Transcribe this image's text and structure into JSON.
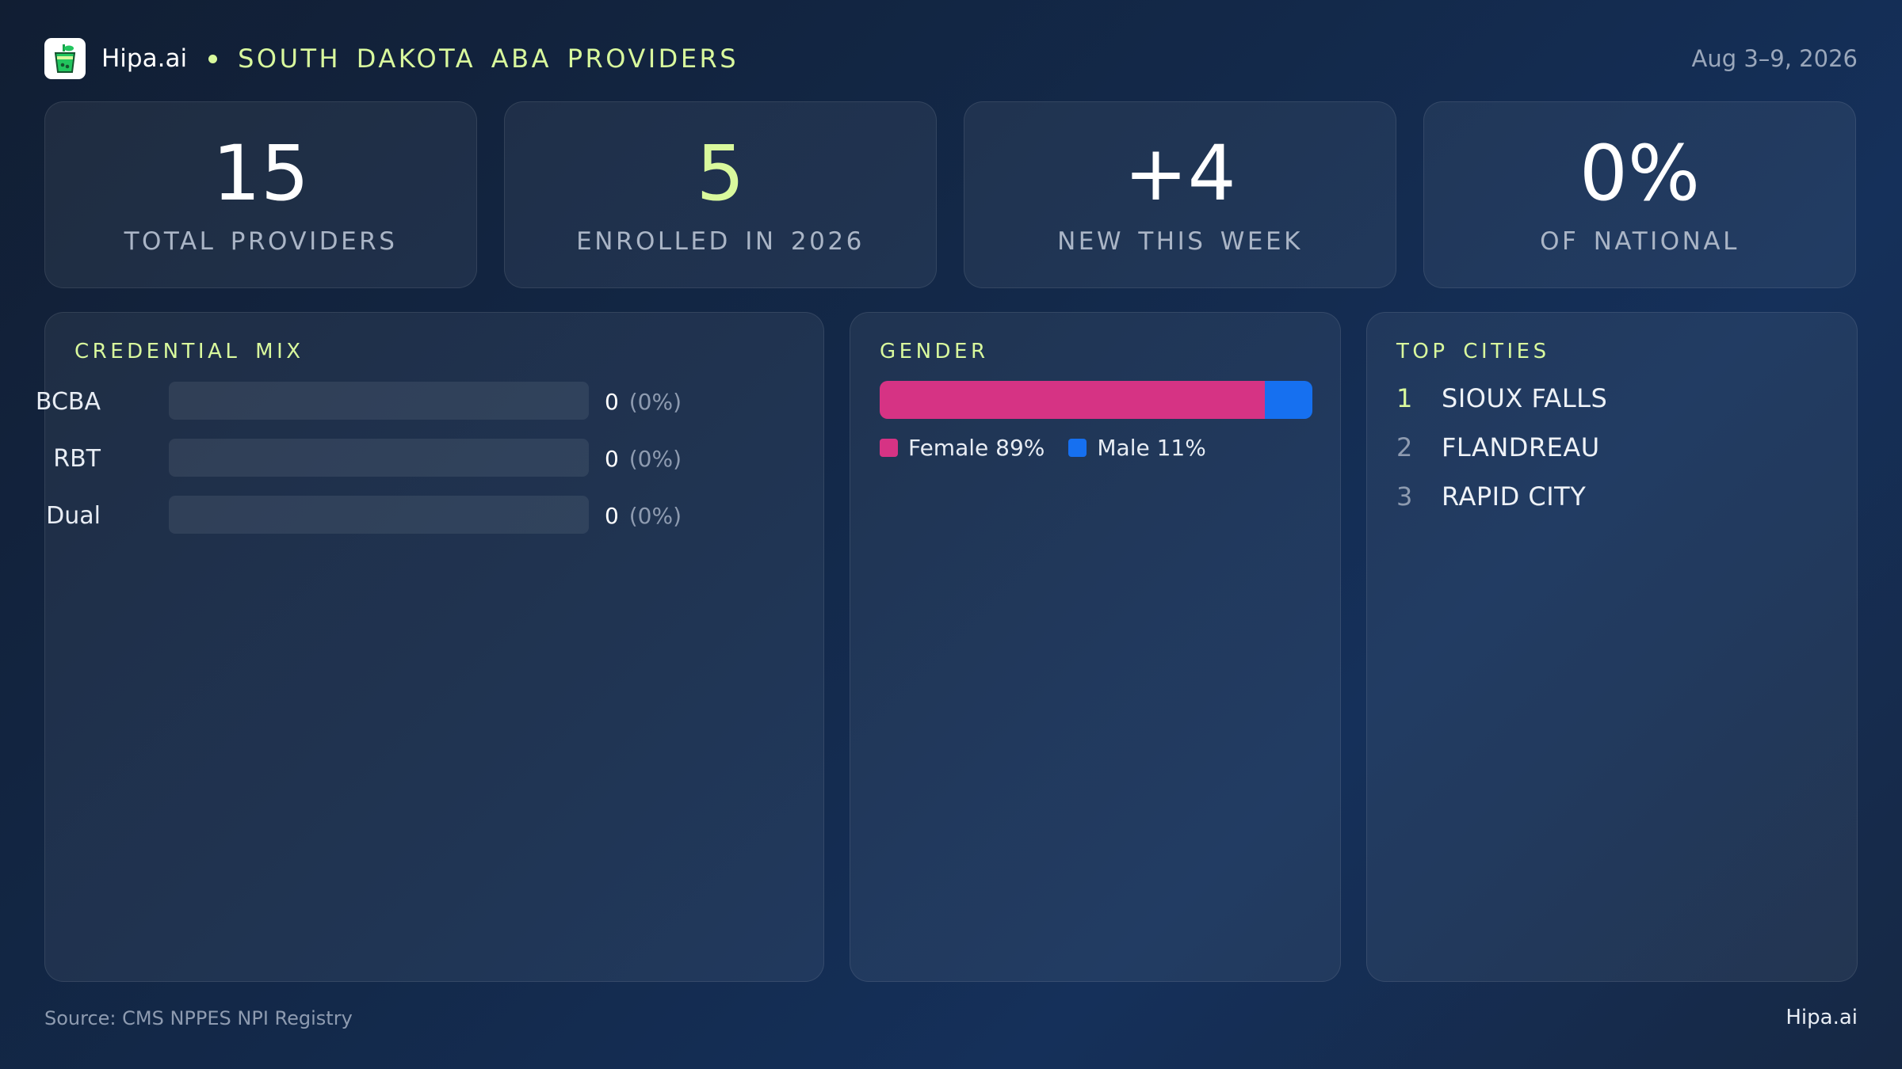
{
  "header": {
    "brand": "Hipa.ai",
    "title": "SOUTH DAKOTA  ABA PROVIDERS",
    "date_range": "Aug 3–9, 2026",
    "logo_icon": "green-cup-logo-icon"
  },
  "stats": [
    {
      "value": "15",
      "label": "TOTAL  PROVIDERS",
      "accent": false
    },
    {
      "value": "5",
      "label": "ENROLLED IN 2026",
      "accent": true
    },
    {
      "value": "+4",
      "label": "NEW THIS WEEK",
      "accent": false
    },
    {
      "value": "0%",
      "label": "OF NATIONAL",
      "accent": false
    }
  ],
  "credential_mix": {
    "title": "CREDENTIAL  MIX",
    "rows": [
      {
        "label": "BCBA",
        "count": "0",
        "pct": "(0%)",
        "fraction": 0
      },
      {
        "label": "RBT",
        "count": "0",
        "pct": "(0%)",
        "fraction": 0
      },
      {
        "label": "Dual",
        "count": "0",
        "pct": "(0%)",
        "fraction": 0
      }
    ]
  },
  "gender": {
    "title": "GENDER",
    "segments": [
      {
        "label": "Female 89%",
        "fraction": 0.89,
        "color": "#d63384"
      },
      {
        "label": "Male 11%",
        "fraction": 0.11,
        "color": "#1670f0"
      }
    ]
  },
  "top_cities": {
    "title": "TOP CITIES",
    "items": [
      {
        "rank": "1",
        "name": "SIOUX FALLS"
      },
      {
        "rank": "2",
        "name": "FLANDREAU"
      },
      {
        "rank": "3",
        "name": "RAPID CITY"
      }
    ]
  },
  "footer": {
    "source": "Source: CMS NPPES NPI Registry",
    "brand": "Hipa.ai"
  },
  "colors": {
    "accent": "#d9f99d",
    "female": "#d63384",
    "male": "#1670f0",
    "background": "#13294a"
  }
}
